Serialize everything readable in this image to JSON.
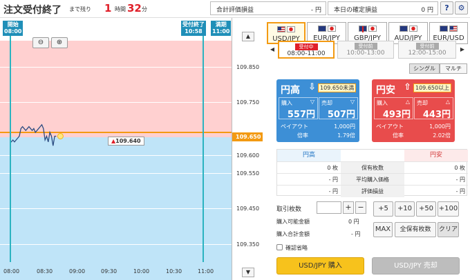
{
  "header": {
    "status": "注文受付終了",
    "remaining_label": "まで残り",
    "hours_value": "1",
    "hours_unit": "時間",
    "minutes_value": "32",
    "minutes_unit": "分",
    "total_valuation_label": "合計評価損益",
    "total_valuation_value": "- 円",
    "today_pl_label": "本日の確定損益",
    "today_pl_value": "0 円",
    "help_label": "?",
    "settings_icon": "gear-icon"
  },
  "chart_data": {
    "type": "line",
    "x_ticks": [
      "08:00",
      "08:30",
      "09:00",
      "09:30",
      "10:00",
      "10:30",
      "11:00"
    ],
    "y_ticks": [
      "109.850",
      "109.750",
      "109.650",
      "109.600",
      "109.550",
      "109.450",
      "109.350"
    ],
    "ylim": [
      109.31,
      109.95
    ],
    "current_price": "109.650",
    "last_price": "109.640",
    "start_marker": {
      "label": "開始",
      "time": "08:00"
    },
    "end_accept_marker": {
      "label": "受付終了",
      "time": "10:58"
    },
    "expiry_marker": {
      "label": "満期",
      "time": "11:00"
    },
    "series": [
      {
        "values": [
          109.625,
          109.625,
          109.63,
          109.625,
          109.63,
          109.635,
          109.64,
          109.66,
          109.665,
          109.66,
          109.655,
          109.66,
          109.665,
          109.66,
          109.655,
          109.66,
          109.65,
          109.655,
          109.66,
          109.665,
          109.67,
          109.66,
          109.63,
          109.64,
          109.625,
          109.65,
          109.64,
          109.615,
          109.64,
          109.64
        ]
      }
    ],
    "x_start_minute": 0,
    "x_step_minutes": 1.5
  },
  "chart_controls": {
    "zoom_out_icon": "zoom-out-icon",
    "zoom_in_icon": "zoom-in-icon",
    "scroll_up": "▲",
    "scroll_down": "▼"
  },
  "pairs": [
    {
      "label": "USD/JPY",
      "active": true
    },
    {
      "label": "EUR/JPY",
      "active": false
    },
    {
      "label": "GBP/JPY",
      "active": false
    },
    {
      "label": "AUD/JPY",
      "active": false
    },
    {
      "label": "EUR/USD",
      "active": false
    }
  ],
  "sessions": [
    {
      "badge": "受付中",
      "time": "08:00-11:00",
      "active": true
    },
    {
      "badge": "受付前",
      "time": "10:00-13:00",
      "active": false
    },
    {
      "badge": "受付前",
      "time": "12:00-15:00",
      "active": false
    }
  ],
  "modes": {
    "single": "シングル",
    "multi": "マルチ"
  },
  "cards": {
    "high": {
      "title": "円高",
      "badge": "109.650未満",
      "buy_label": "購入",
      "buy_value": "557円",
      "sell_label": "売却",
      "sell_value": "507円",
      "payout_label": "ペイアウト",
      "payout_value": "1,000円",
      "rate_label": "倍率",
      "rate_value": "1.79倍"
    },
    "low": {
      "title": "円安",
      "badge": "109.650以上",
      "buy_label": "購入",
      "buy_value": "493円",
      "sell_label": "売却",
      "sell_value": "443円",
      "payout_label": "ペイアウト",
      "payout_value": "1,000円",
      "rate_label": "倍率",
      "rate_value": "2.02倍"
    }
  },
  "position_table": {
    "left_head": "円高",
    "right_head": "円安",
    "rows": [
      {
        "label": "保有枚数",
        "left": "0 枚",
        "right": "0 枚"
      },
      {
        "label": "平均購入価格",
        "left": "- 円",
        "right": "- 円"
      },
      {
        "label": "評価損益",
        "left": "- 円",
        "right": "- 円"
      }
    ]
  },
  "order": {
    "quantity_label": "取引枚数",
    "quantity_value": "",
    "plus": "+",
    "minus": "−",
    "available_label": "購入可能金額",
    "available_value": "0 円",
    "total_label": "購入合計金額",
    "total_value": "- 円",
    "quick": [
      "+5",
      "+10",
      "+50",
      "+100"
    ],
    "max_label": "MAX",
    "all_label": "全保有枚数",
    "clear_label": "クリア",
    "confirm_skip_label": "確認省略",
    "buy_label": "USD/JPY 購入",
    "sell_label": "USD/JPY 売却"
  }
}
